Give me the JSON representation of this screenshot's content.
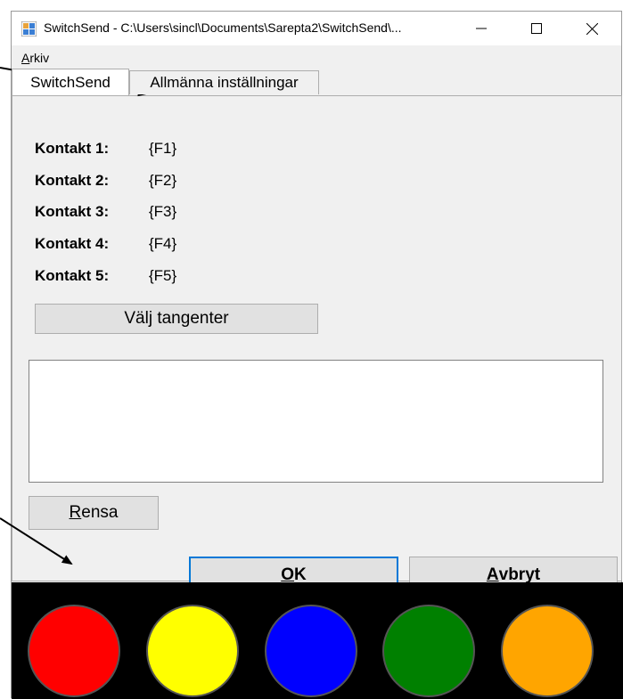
{
  "window": {
    "title": "SwitchSend - C:\\Users\\sincl\\Documents\\Sarepta2\\SwitchSend\\...",
    "controls": [
      "minimize-icon",
      "maximize-icon",
      "close-icon"
    ]
  },
  "menu": {
    "arkiv_first": "A",
    "arkiv_rest": "rkiv"
  },
  "tabs": [
    {
      "label": "SwitchSend",
      "active": true
    },
    {
      "label": "Allmänna inställningar",
      "active": false
    }
  ],
  "contacts": [
    {
      "label": "Kontakt 1:",
      "value": "{F1}"
    },
    {
      "label": "Kontakt 2:",
      "value": "{F2}"
    },
    {
      "label": "Kontakt 3:",
      "value": "{F3}"
    },
    {
      "label": "Kontakt 4:",
      "value": "{F4}"
    },
    {
      "label": "Kontakt 5:",
      "value": "{F5}"
    }
  ],
  "buttons": {
    "valj": "Välj tangenter",
    "rensa_first": "R",
    "rensa_rest": "ensa",
    "ok_first": "O",
    "ok_rest": "K",
    "avbryt_first": "A",
    "avbryt_rest": "vbryt"
  },
  "log_text": "",
  "switch_colors": [
    "#ff0000",
    "#ffff00",
    "#0000ff",
    "#008000",
    "#ffa500"
  ]
}
